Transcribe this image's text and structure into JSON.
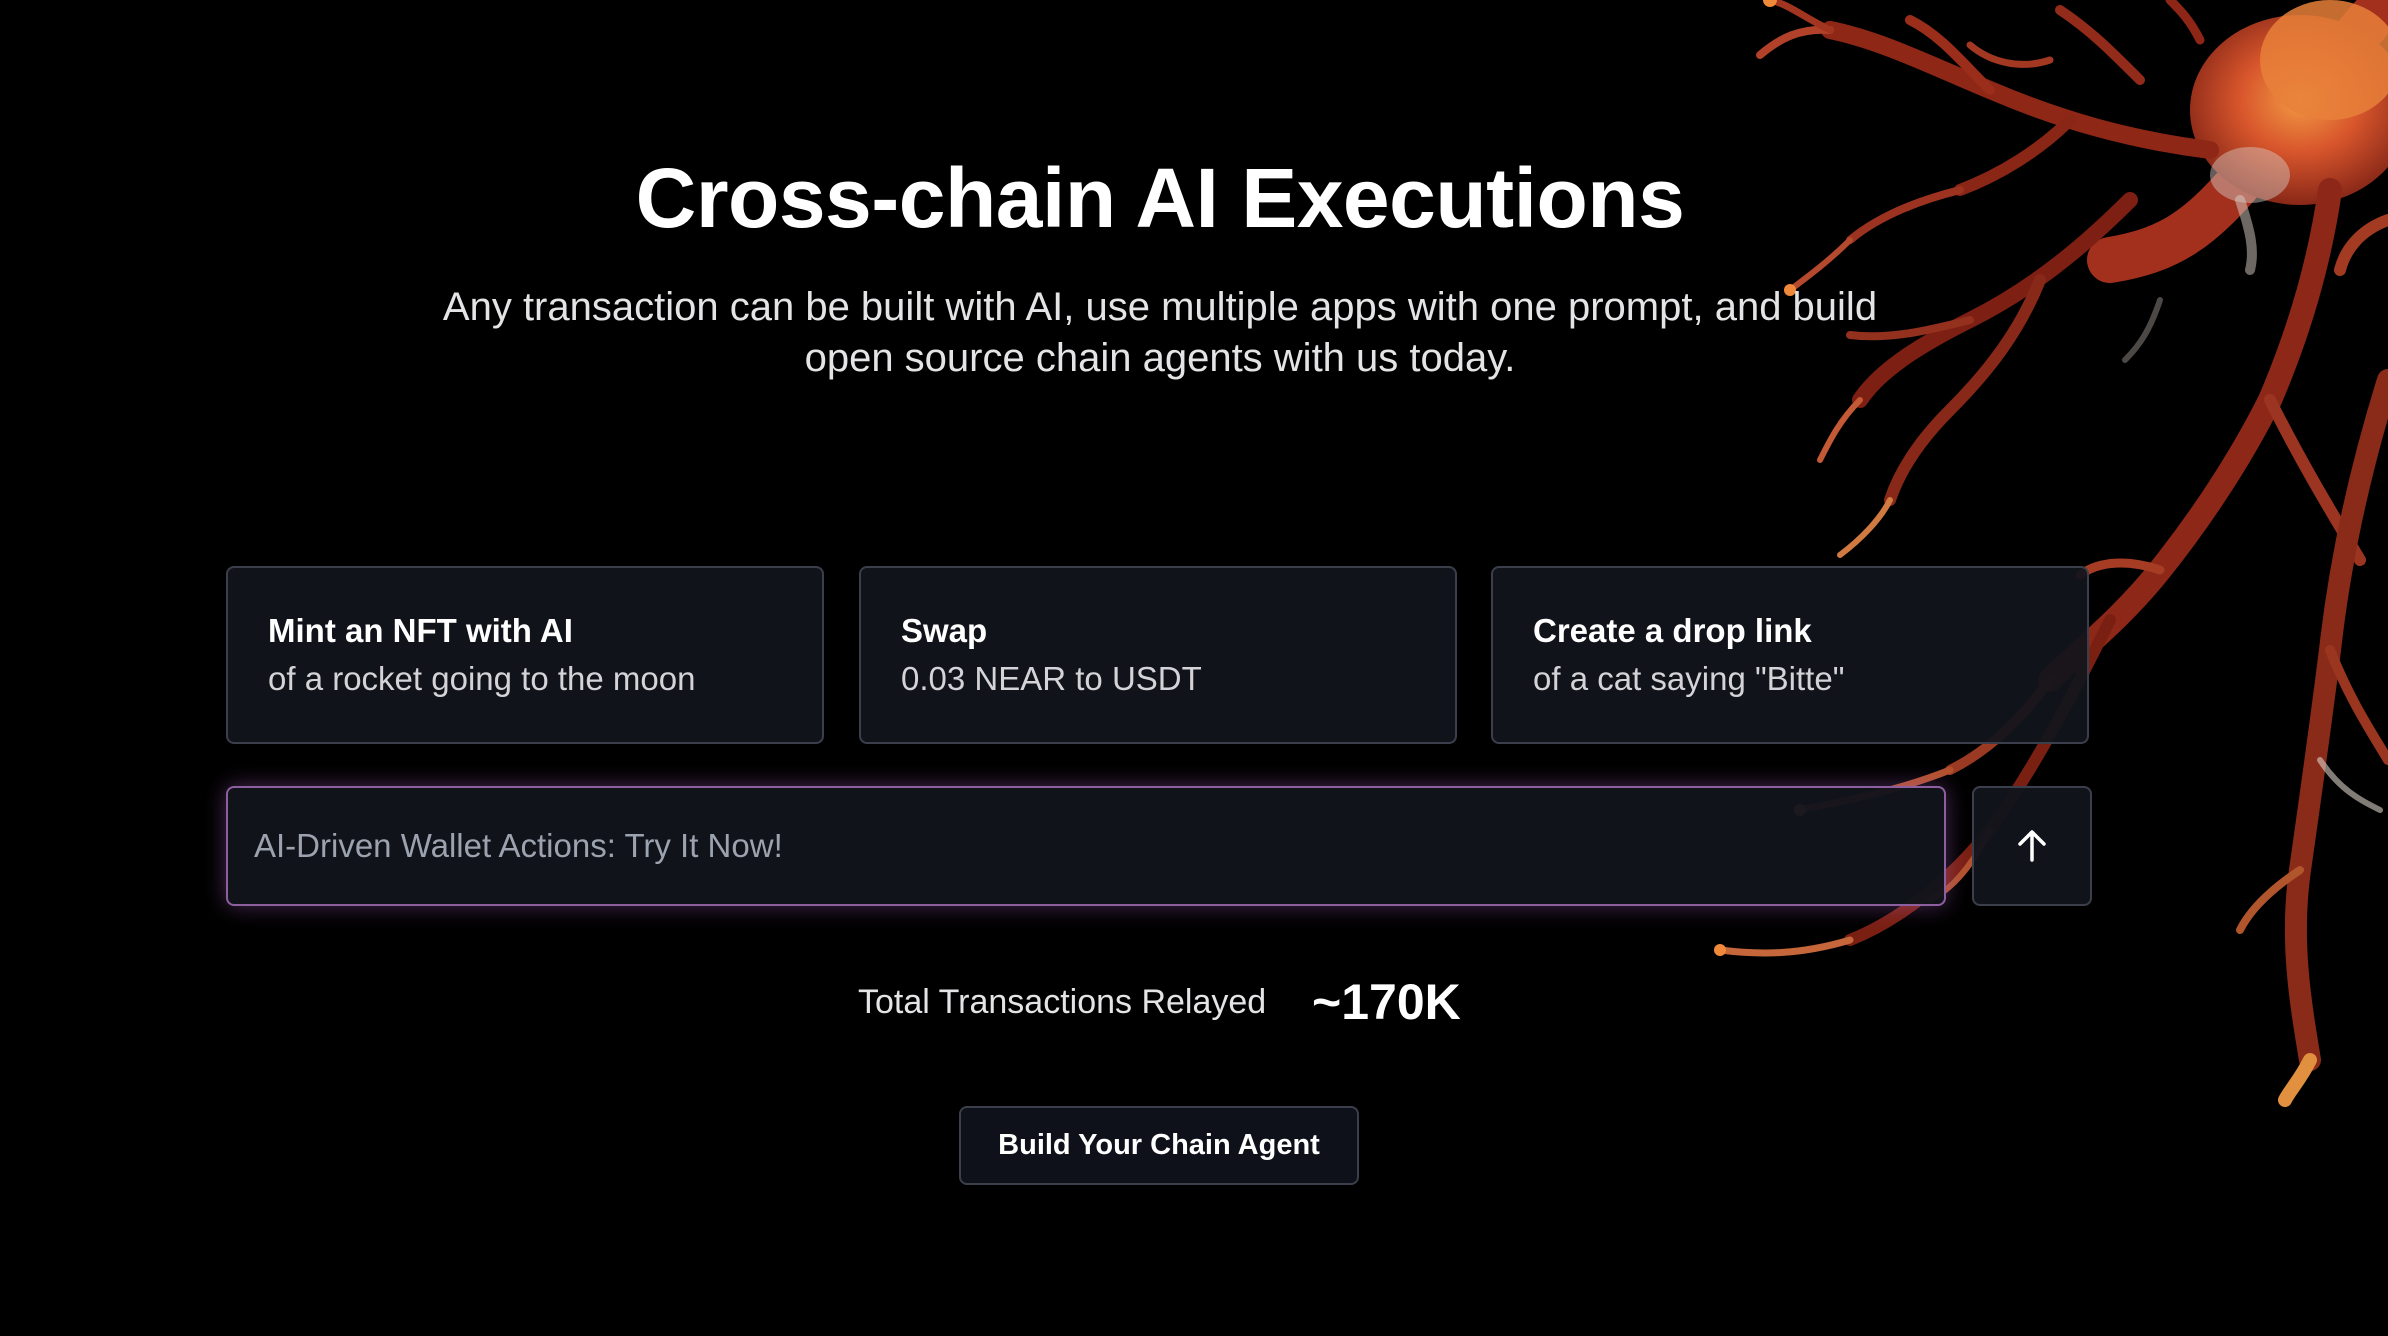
{
  "hero": {
    "title": "Cross-chain AI Executions",
    "subtitle_line1": "Any transaction can be built with AI, use multiple apps with one prompt, and build",
    "subtitle_line2": "open source chain agents with us today."
  },
  "suggestions": [
    {
      "title": "Mint an NFT with AI",
      "description": "of a rocket going to the moon"
    },
    {
      "title": "Swap",
      "description": "0.03 NEAR to USDT"
    },
    {
      "title": "Create a drop link",
      "description": "of a cat saying \"Bitte\""
    }
  ],
  "prompt": {
    "placeholder": "AI-Driven Wallet Actions: Try It Now!",
    "value": "",
    "send_icon": "arrow-up-icon"
  },
  "stats": {
    "label": "Total Transactions Relayed",
    "value": "~170K"
  },
  "cta": {
    "label": "Build Your Chain Agent"
  },
  "decoration": {
    "icon": "neuron-illustration",
    "colors": {
      "primary": "#c2412a",
      "highlight": "#f08a3a",
      "pale": "#d9cfc7"
    }
  },
  "theme": {
    "background": "#000000",
    "card_border": "#3a3f4b",
    "prompt_glow": "#be6edc"
  }
}
